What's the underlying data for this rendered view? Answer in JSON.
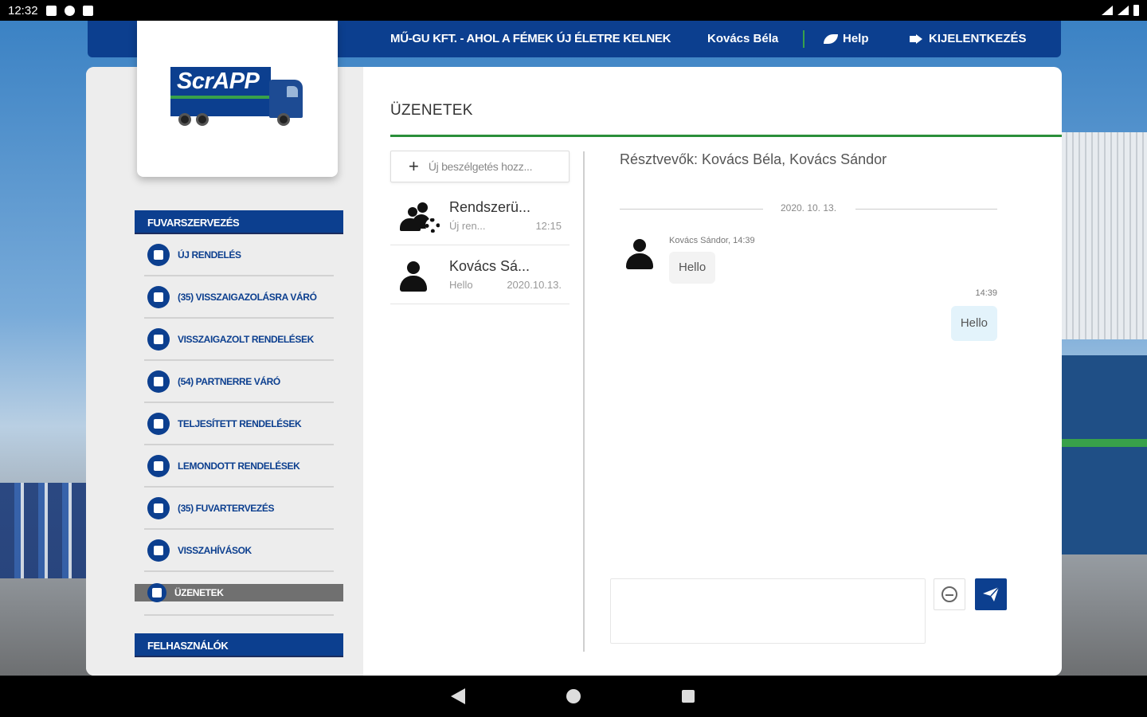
{
  "status_bar": {
    "time": "12:32"
  },
  "header": {
    "company": "MŰ-GU KFT. - AHOL A FÉMEK ÚJ ÉLETRE KELNEK",
    "user": "Kovács Béla",
    "help": "Help",
    "logout": "KIJELENTKEZÉS"
  },
  "logo": {
    "text": "ScrAPP"
  },
  "sidebar": {
    "section_orders": "FUVARSZERVEZÉS",
    "items": [
      {
        "label": "ÚJ RENDELÉS",
        "icon": "cart-icon"
      },
      {
        "label": "(35) VISSZAIGAZOLÁSRA VÁRÓ",
        "icon": "clipboard-edit-icon"
      },
      {
        "label": "VISSZAIGAZOLT RENDELÉSEK",
        "icon": "handshake-icon"
      },
      {
        "label": "(54) PARTNERRE VÁRÓ",
        "icon": "clock-icon"
      },
      {
        "label": "TELJESÍTETT RENDELÉSEK",
        "icon": "list-icon"
      },
      {
        "label": "LEMONDOTT RENDELÉSEK",
        "icon": "ban-icon"
      },
      {
        "label": "(35) FUVARTERVEZÉS",
        "icon": "calendar-icon"
      },
      {
        "label": "VISSZAHÍVÁSOK",
        "icon": "phone-back-icon"
      }
    ],
    "active_item": {
      "label": "ÜZENETEK",
      "icon": "chat-icon"
    },
    "section_users": "FELHASZNÁLÓK"
  },
  "messages": {
    "title": "ÜZENETEK",
    "new_conversation": "Új beszélgetés hozz...",
    "conversations": [
      {
        "name": "Rendszerü...",
        "preview": "Új ren...",
        "time": "12:15",
        "icon": "group-settings-icon"
      },
      {
        "name": "Kovács Sá...",
        "preview": "Hello",
        "time": "2020.10.13.",
        "icon": "person-icon"
      }
    ],
    "participants": "Résztvevők: Kovács Béla, Kovács Sándor",
    "date_separator": "2020. 10. 13.",
    "incoming": {
      "meta": "Kovács Sándor, 14:39",
      "text": "Hello"
    },
    "outgoing": {
      "meta": "14:39",
      "text": "Hello"
    }
  },
  "colors": {
    "brand_blue": "#0c3f8f",
    "accent_green": "#2a8f3a",
    "active_gray": "#707070"
  }
}
